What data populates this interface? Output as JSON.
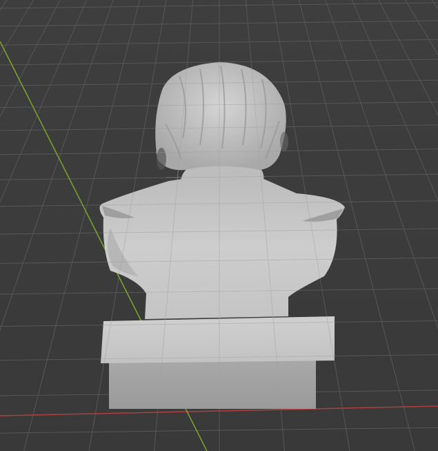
{
  "viewport": {
    "background": "#3b3b3b",
    "grid_color": "#575757",
    "x_axis_color": "#b0403f",
    "y_axis_color": "#7fa52c",
    "model_color": "#c9c9c9"
  },
  "scene": {
    "object": "bust-on-pedestal",
    "view": "back"
  }
}
